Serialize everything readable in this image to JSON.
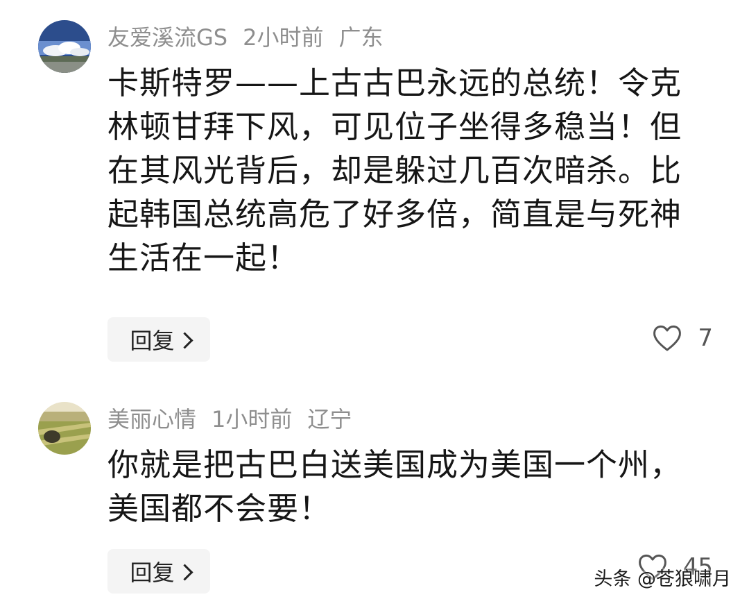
{
  "comments": [
    {
      "username": "友爱溪流GS",
      "time": "2小时前",
      "location": "广东",
      "text": "卡斯特罗——上古古巴永远的总统！令克林顿甘拜下风，可见位子坐得多稳当！但在其风光背后，却是躲过几百次暗杀。比起韩国总统高危了好多倍，简直是与死神生活在一起！",
      "reply_label": "回复",
      "likes": "7"
    },
    {
      "username": "美丽心情",
      "time": "1小时前",
      "location": "辽宁",
      "text": "你就是把古巴白送美国成为美国一个州，美国都不会要！",
      "reply_label": "回复",
      "likes": "45"
    }
  ],
  "watermark": "头条 @苍狼啸月",
  "icons": {
    "like": "heart-outline-icon",
    "reply_arrow": "chevron-right-icon"
  },
  "colors": {
    "meta_text": "#8e8e8e",
    "body_text": "#161616",
    "reply_bg": "#f4f4f4"
  }
}
